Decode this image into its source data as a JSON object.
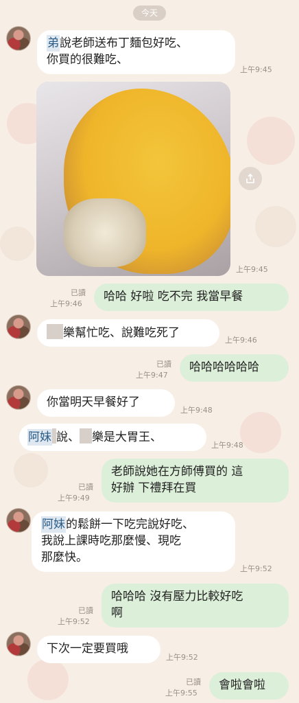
{
  "date_divider": "今天",
  "messages": [
    {
      "id": "m1",
      "dir": "in",
      "text_tag": "弟",
      "text": "說老師送布丁麵包好吃、\n你買的很難吃、",
      "time": "上午9:45"
    },
    {
      "id": "m2",
      "dir": "in",
      "type": "photo",
      "time": "上午9:45"
    },
    {
      "id": "m3",
      "dir": "out",
      "text": "哈哈 好啦 吃不完 我當早餐",
      "read": "已讀",
      "time": "上午9:46"
    },
    {
      "id": "m4",
      "dir": "in",
      "text": "樂幫忙吃、說難吃死了",
      "time": "上午9:46"
    },
    {
      "id": "m5",
      "dir": "out",
      "text": "哈哈哈哈哈哈",
      "read": "已讀",
      "time": "上午9:47"
    },
    {
      "id": "m6",
      "dir": "in",
      "text": "你當明天早餐好了",
      "time": "上午9:48"
    },
    {
      "id": "m7",
      "dir": "in",
      "text_tag": "阿妹",
      "text_a": "說、",
      "text_b": "樂是大胃王、",
      "time": "上午9:48"
    },
    {
      "id": "m8",
      "dir": "out",
      "text": "老師說她在方師傅買的 這\n好辦 下禮拜在買",
      "read": "已讀",
      "time": "上午9:49"
    },
    {
      "id": "m9",
      "dir": "in",
      "text_tag": "阿妹",
      "text": "的鬆餅一下吃完說好吃、\n我說上課時吃那麼慢、現吃\n那麼快。",
      "time": "上午9:52"
    },
    {
      "id": "m10",
      "dir": "out",
      "text": "哈哈哈 沒有壓力比較好吃\n啊",
      "read": "已讀",
      "time": "上午9:52"
    },
    {
      "id": "m11",
      "dir": "in",
      "text": "下次一定要買哦",
      "time": "上午9:52"
    },
    {
      "id": "m12",
      "dir": "out",
      "text": "會啦會啦",
      "read": "已讀",
      "time": "上午9:55"
    }
  ],
  "icons": {
    "share": "share-icon",
    "avatar": "contact-avatar"
  }
}
